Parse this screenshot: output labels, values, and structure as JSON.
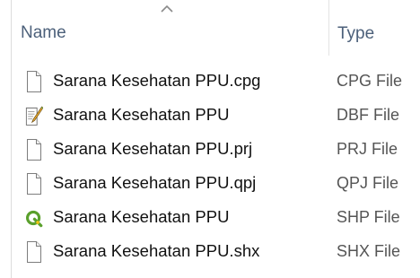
{
  "header": {
    "name_label": "Name",
    "type_label": "Type",
    "sort_icon": "sort-ascending-caret"
  },
  "files": [
    {
      "name": "Sarana Kesehatan PPU.cpg",
      "type": "CPG File",
      "icon": "document-icon"
    },
    {
      "name": "Sarana Kesehatan PPU",
      "type": "DBF File",
      "icon": "dbf-document-edit-icon"
    },
    {
      "name": "Sarana Kesehatan PPU.prj",
      "type": "PRJ File",
      "icon": "document-icon"
    },
    {
      "name": "Sarana Kesehatan PPU.qpj",
      "type": "QPJ File",
      "icon": "document-icon"
    },
    {
      "name": "Sarana Kesehatan PPU",
      "type": "SHP File",
      "icon": "qgis-icon"
    },
    {
      "name": "Sarana Kesehatan PPU.shx",
      "type": "SHX File",
      "icon": "document-icon"
    }
  ],
  "colors": {
    "header_text": "#4c607a",
    "name_text": "#111111",
    "type_text": "#555555",
    "qgis_green": "#5aa02c",
    "qgis_yellow": "#f0c419",
    "pencil_yellow": "#f2b233",
    "pencil_green": "#6aa84f"
  }
}
